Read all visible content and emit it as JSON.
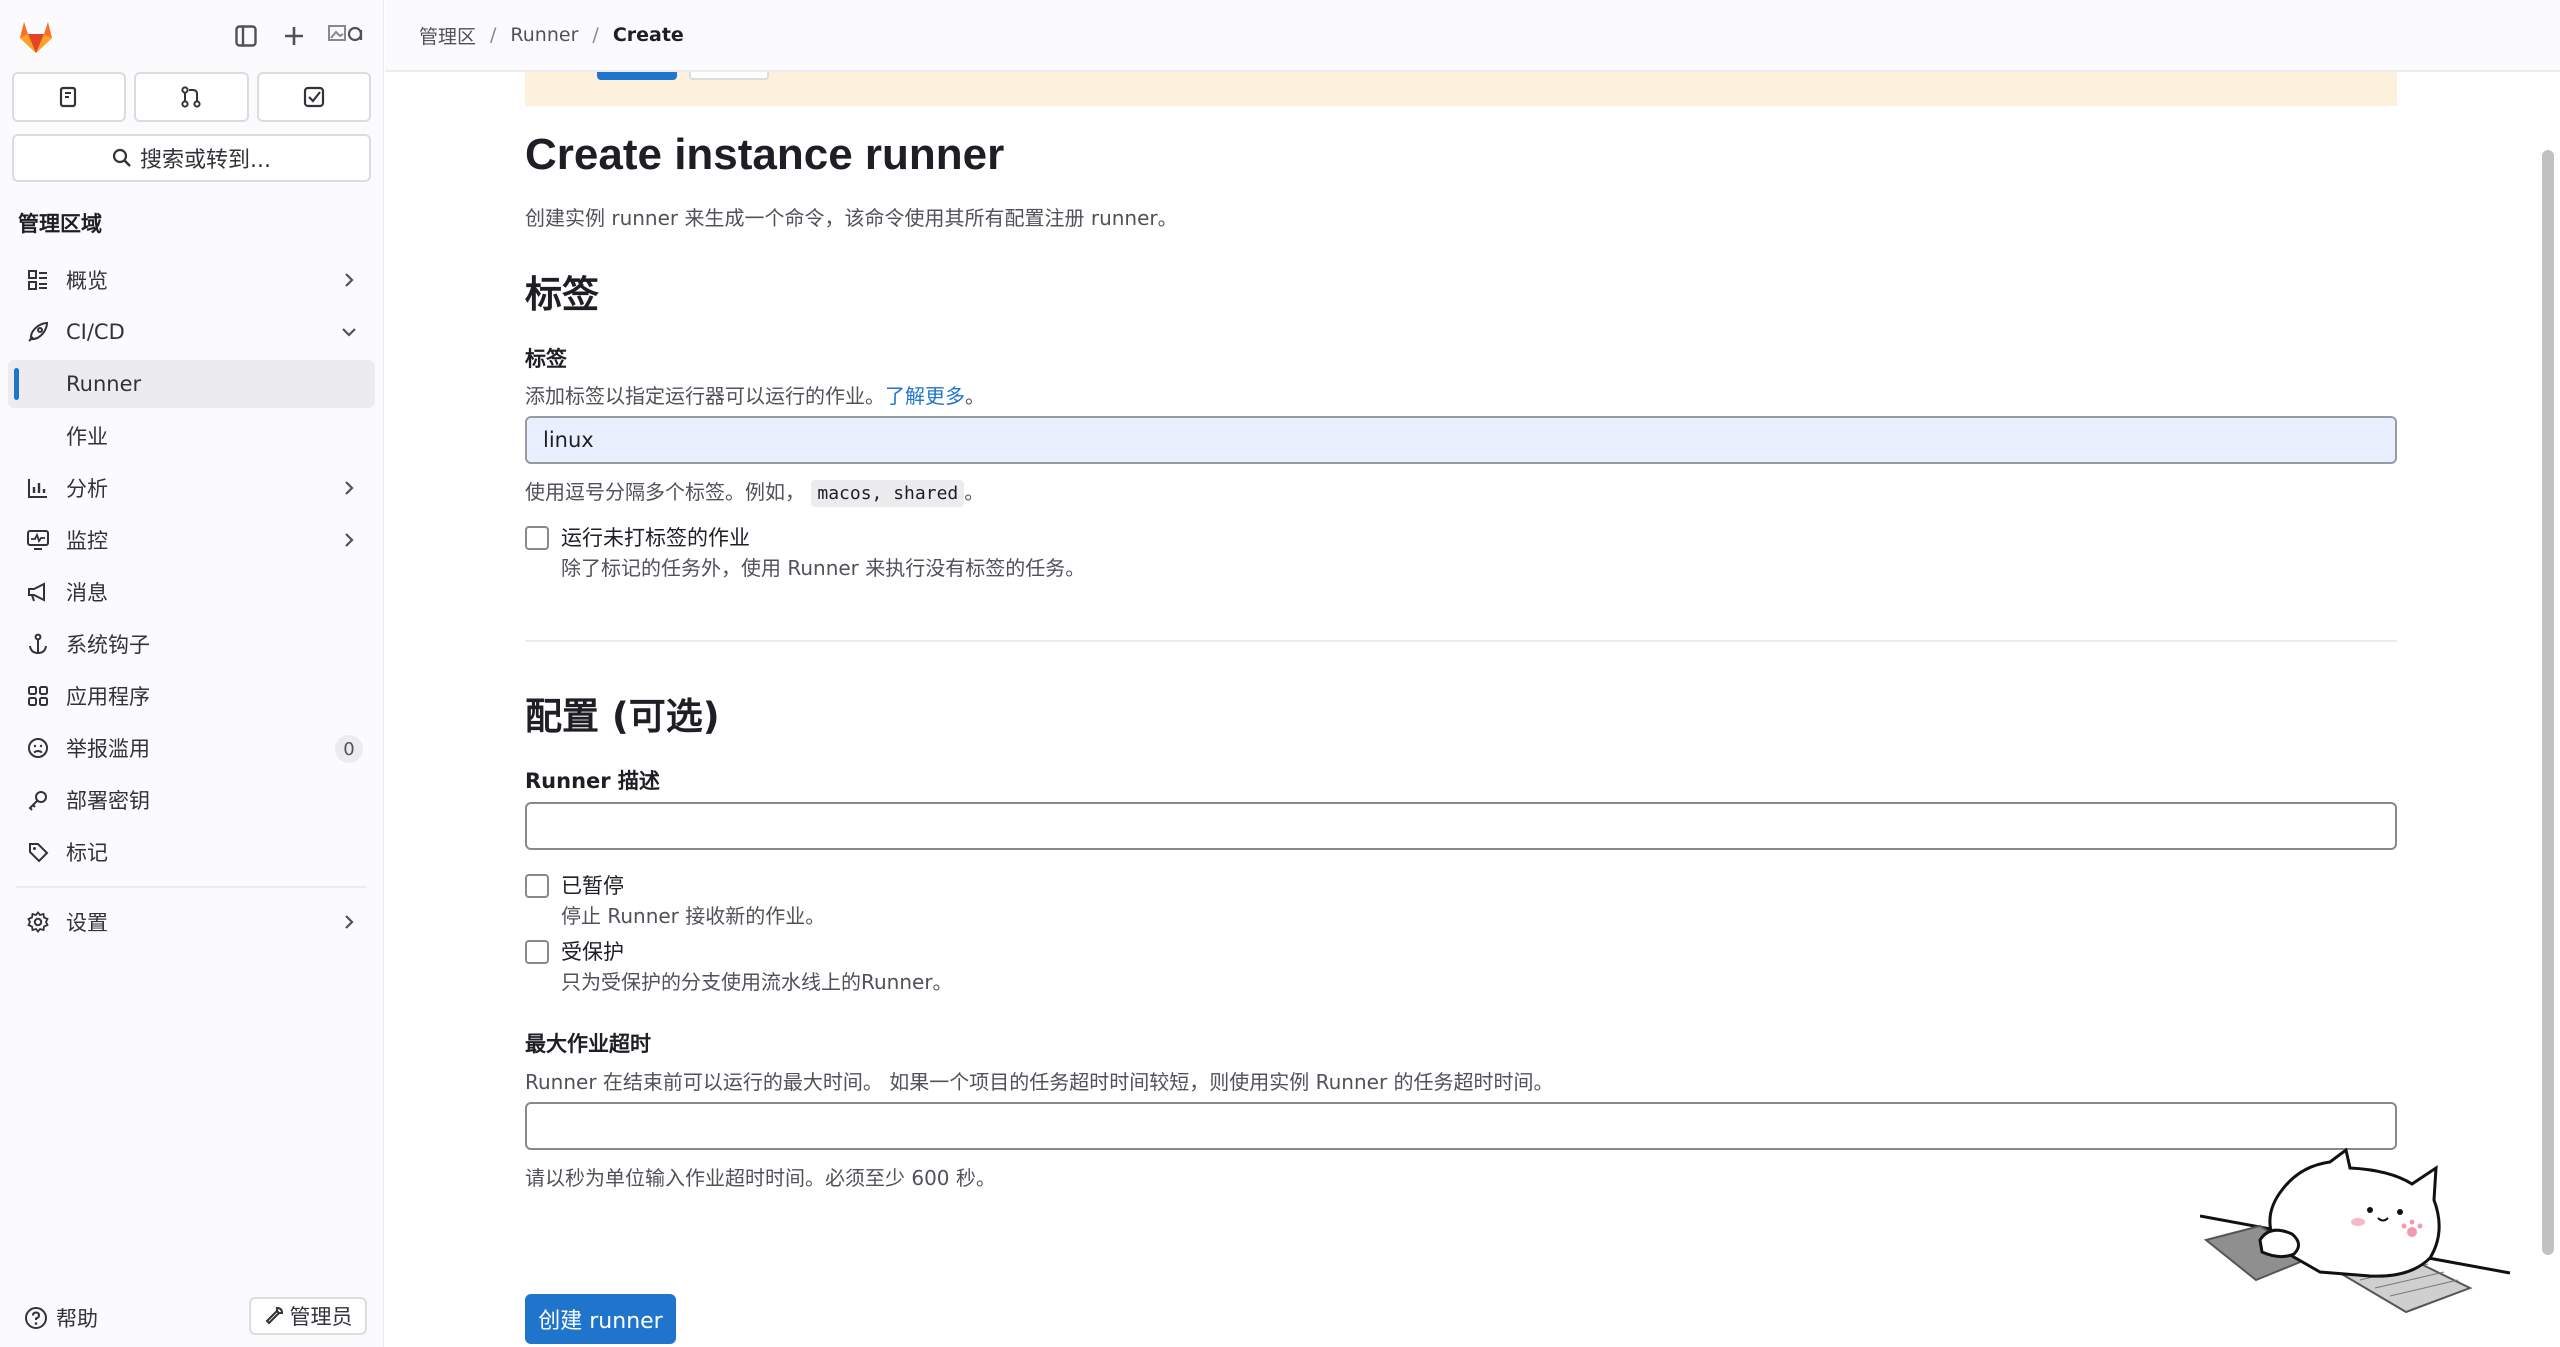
{
  "breadcrumb": {
    "items": [
      "管理区",
      "Runner"
    ],
    "current": "Create"
  },
  "sidebar": {
    "search_label": "搜索或转到...",
    "section_title": "管理区域",
    "items": [
      {
        "label": "概览",
        "icon": "overview-icon"
      },
      {
        "label": "CI/CD",
        "icon": "rocket-icon"
      },
      {
        "label": "Runner"
      },
      {
        "label": "作业"
      },
      {
        "label": "分析",
        "icon": "chart-icon"
      },
      {
        "label": "监控",
        "icon": "monitor-icon"
      },
      {
        "label": "消息",
        "icon": "megaphone-icon"
      },
      {
        "label": "系统钩子",
        "icon": "anchor-icon"
      },
      {
        "label": "应用程序",
        "icon": "apps-icon"
      },
      {
        "label": "举报滥用",
        "icon": "face-icon",
        "count": "0"
      },
      {
        "label": "部署密钥",
        "icon": "key-icon"
      },
      {
        "label": "标记",
        "icon": "label-icon"
      },
      {
        "label": "设置",
        "icon": "gear-icon"
      }
    ],
    "help_label": "帮助",
    "admin_label": "管理员"
  },
  "page": {
    "title": "Create instance runner",
    "description": "创建实例 runner 来生成一个命令，该命令使用其所有配置注册 runner。",
    "tags_section": {
      "heading": "标签",
      "label": "标签",
      "help": "添加标签以指定运行器可以运行的作业。",
      "link": "了解更多",
      "period": "。",
      "value": "linux",
      "hint_prefix": "使用逗号分隔多个标签。例如，",
      "hint_code": "macos, shared",
      "hint_suffix": "。",
      "untagged_title": "运行未打标签的作业",
      "untagged_desc": "除了标记的任务外，使用 Runner 来执行没有标签的任务。"
    },
    "config_section": {
      "heading": "配置 (可选)",
      "description_label": "Runner 描述",
      "description_value": "",
      "paused_title": "已暂停",
      "paused_desc": "停止 Runner 接收新的作业。",
      "protected_title": "受保护",
      "protected_desc": "只为受保护的分支使用流水线上的Runner。",
      "timeout_label": "最大作业超时",
      "timeout_help": "Runner 在结束前可以运行的最大时间。 如果一个项目的任务超时时间较短，则使用实例 Runner 的任务超时时间。",
      "timeout_value": "",
      "timeout_hint": "请以秒为单位输入作业超时时间。必须至少 600 秒。"
    },
    "submit_label": "创建 runner"
  },
  "colors": {
    "accent": "#1f75cb",
    "banner": "#fdf1dd",
    "sidebar_bg": "#fbfafd"
  }
}
